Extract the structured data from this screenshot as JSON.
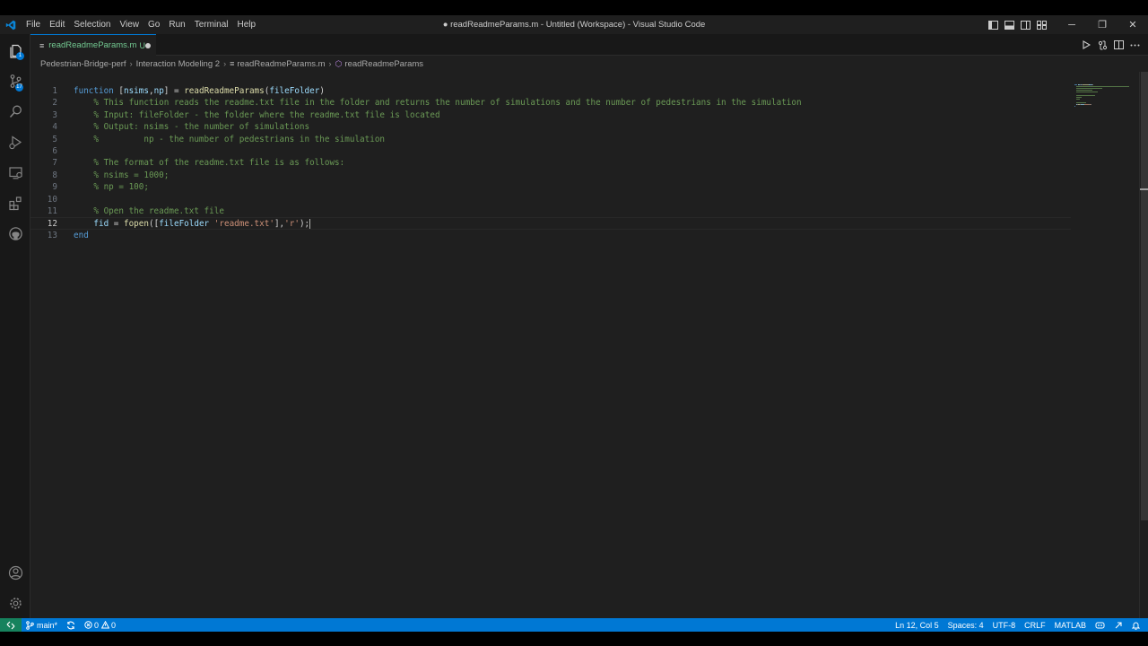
{
  "window": {
    "title": "● readReadmeParams.m - Untitled (Workspace) - Visual Studio Code",
    "menu": [
      "File",
      "Edit",
      "Selection",
      "View",
      "Go",
      "Run",
      "Terminal",
      "Help"
    ],
    "controls": {
      "minimize": "─",
      "restore": "❐",
      "close": "✕"
    }
  },
  "activity_bar": {
    "items": [
      {
        "name": "explorer",
        "icon": "files-icon",
        "badge": "1"
      },
      {
        "name": "source-control",
        "icon": "source-control-icon",
        "badge": "17"
      },
      {
        "name": "search",
        "icon": "search-icon"
      },
      {
        "name": "run-and-debug",
        "icon": "run-debug-icon"
      },
      {
        "name": "remote-explorer",
        "icon": "remote-explorer-icon"
      },
      {
        "name": "extensions",
        "icon": "extensions-icon"
      },
      {
        "name": "github",
        "icon": "github-icon"
      }
    ],
    "bottom": [
      {
        "name": "accounts",
        "icon": "account-icon"
      },
      {
        "name": "manage",
        "icon": "gear-icon"
      }
    ]
  },
  "tab": {
    "icon": "≡",
    "label": "readReadmeParams.m",
    "status": "U"
  },
  "breadcrumb": {
    "items": [
      "Pedestrian-Bridge-perf",
      "Interaction Modeling 2",
      "readReadmeParams.m",
      "readReadmeParams"
    ]
  },
  "editor": {
    "language": "MATLAB",
    "active_line": 12,
    "lines": [
      {
        "n": "1",
        "tokens": [
          {
            "t": "kw",
            "v": "function"
          },
          {
            "t": "pl",
            "v": " ["
          },
          {
            "t": "id",
            "v": "nsims"
          },
          {
            "t": "pl",
            "v": ","
          },
          {
            "t": "id",
            "v": "np"
          },
          {
            "t": "pl",
            "v": "] = "
          },
          {
            "t": "fn",
            "v": "readReadmeParams"
          },
          {
            "t": "pl",
            "v": "("
          },
          {
            "t": "id",
            "v": "fileFolder"
          },
          {
            "t": "pl",
            "v": ")"
          }
        ]
      },
      {
        "n": "2",
        "tokens": [
          {
            "t": "cm",
            "v": "    % This function reads the readme.txt file in the folder and returns the number of simulations and the number of pedestrians in the simulation"
          }
        ]
      },
      {
        "n": "3",
        "tokens": [
          {
            "t": "cm",
            "v": "    % Input: fileFolder - the folder where the readme.txt file is located"
          }
        ]
      },
      {
        "n": "4",
        "tokens": [
          {
            "t": "cm",
            "v": "    % Output: nsims - the number of simulations"
          }
        ]
      },
      {
        "n": "5",
        "tokens": [
          {
            "t": "cm",
            "v": "    %         np - the number of pedestrians in the simulation"
          }
        ]
      },
      {
        "n": "6",
        "tokens": []
      },
      {
        "n": "7",
        "tokens": [
          {
            "t": "cm",
            "v": "    % The format of the readme.txt file is as follows:"
          }
        ]
      },
      {
        "n": "8",
        "tokens": [
          {
            "t": "cm",
            "v": "    % nsims = 1000;"
          }
        ]
      },
      {
        "n": "9",
        "tokens": [
          {
            "t": "cm",
            "v": "    % np = 100;"
          }
        ]
      },
      {
        "n": "10",
        "tokens": []
      },
      {
        "n": "11",
        "tokens": [
          {
            "t": "cm",
            "v": "    % Open the readme.txt file"
          }
        ]
      },
      {
        "n": "12",
        "tokens": [
          {
            "t": "pl",
            "v": "    "
          },
          {
            "t": "id",
            "v": "fid"
          },
          {
            "t": "pl",
            "v": " = "
          },
          {
            "t": "fn",
            "v": "fopen"
          },
          {
            "t": "pl",
            "v": "(["
          },
          {
            "t": "id",
            "v": "fileFolder"
          },
          {
            "t": "pl",
            "v": " "
          },
          {
            "t": "st",
            "v": "'readme.txt'"
          },
          {
            "t": "pl",
            "v": "],"
          },
          {
            "t": "st",
            "v": "'r'"
          },
          {
            "t": "pl",
            "v": ");"
          }
        ]
      },
      {
        "n": "13",
        "tokens": [
          {
            "t": "kw",
            "v": "end"
          }
        ]
      }
    ]
  },
  "statusbar": {
    "branch": "main*",
    "errors": "0",
    "warnings": "0",
    "position": "Ln 12, Col 5",
    "spaces": "Spaces: 4",
    "encoding": "UTF-8",
    "eol": "CRLF",
    "language": "MATLAB"
  },
  "colors": {
    "accent": "#0078d4",
    "remote": "#16825d",
    "keyword": "#569cd6",
    "comment": "#6a9955",
    "string": "#ce9178",
    "function": "#dcdcaa",
    "identifier": "#9cdcfe",
    "untracked": "#73c991"
  }
}
